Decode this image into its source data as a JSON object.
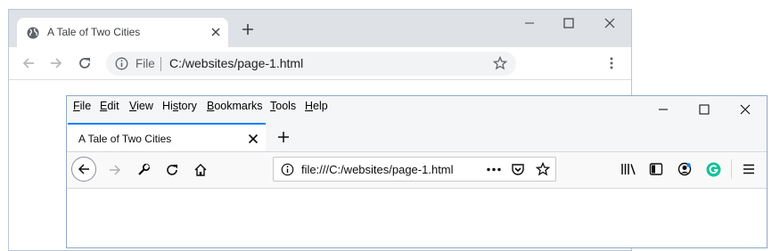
{
  "chrome": {
    "tab_title": "A Tale of Two Cities",
    "omnibox": {
      "scheme_label": "File",
      "url": "C:/websites/page-1.html"
    },
    "icons": [
      "globe-icon",
      "close-icon",
      "plus-icon",
      "minimize-icon",
      "maximize-icon",
      "window-close-icon",
      "back-arrow-icon",
      "forward-arrow-icon",
      "reload-icon",
      "info-icon",
      "star-icon",
      "kebab-menu-icon"
    ]
  },
  "firefox": {
    "menu": [
      "File",
      "Edit",
      "View",
      "History",
      "Bookmarks",
      "Tools",
      "Help"
    ],
    "menu_accel": [
      "F",
      "E",
      "V",
      "s",
      "B",
      "T",
      "H"
    ],
    "tab_title": "A Tale of Two Cities",
    "url": "file:///C:/websites/page-1.html",
    "icons": [
      "back-arrow-icon",
      "forward-arrow-icon",
      "wrench-icon",
      "reload-icon",
      "home-icon",
      "info-icon",
      "more-icon",
      "pocket-icon",
      "star-icon",
      "library-icon",
      "sidebar-icon",
      "account-icon",
      "grammarly-icon",
      "hamburger-menu-icon"
    ],
    "colors": {
      "tab_accent": "#0a84ff",
      "grammarly": "#15c39a"
    }
  }
}
